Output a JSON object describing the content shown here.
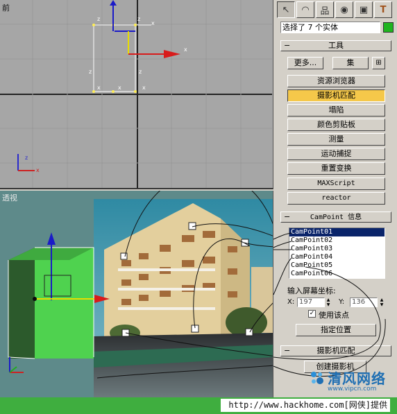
{
  "viewports": {
    "top_label": "前",
    "persp_label": "透视"
  },
  "panel": {
    "tabs": [
      {
        "name": "create-tab-icon",
        "glyph": "↖"
      },
      {
        "name": "modify-tab-icon",
        "glyph": "◠"
      },
      {
        "name": "hierarchy-tab-icon",
        "glyph": "品"
      },
      {
        "name": "motion-tab-icon",
        "glyph": "◉"
      },
      {
        "name": "display-tab-icon",
        "glyph": "▣"
      },
      {
        "name": "utilities-tab-icon",
        "glyph": "T"
      }
    ],
    "selection_text": "选择了 7 个实体",
    "selection_color": "#1fb41f",
    "tools_rollout": "工具",
    "more_button": "更多...",
    "sets_button": "集",
    "buttons": [
      {
        "label": "资源浏览器",
        "highlight": false,
        "mono": false
      },
      {
        "label": "摄影机匹配",
        "highlight": true,
        "mono": false
      },
      {
        "label": "塌陷",
        "highlight": false,
        "mono": false
      },
      {
        "label": "颜色剪贴板",
        "highlight": false,
        "mono": false
      },
      {
        "label": "测量",
        "highlight": false,
        "mono": false
      },
      {
        "label": "运动捕捉",
        "highlight": false,
        "mono": false
      },
      {
        "label": "重置变换",
        "highlight": false,
        "mono": false
      },
      {
        "label": "MAXScript",
        "highlight": false,
        "mono": true
      },
      {
        "label": "reactor",
        "highlight": false,
        "mono": true
      }
    ],
    "campoint_rollout": "CamPoint 信息",
    "campoints": [
      "CamPoint01",
      "CamPoint02",
      "CamPoint03",
      "CamPoint04",
      "CamPoint05",
      "CamPoint06"
    ],
    "screen_coords_label": "输入屏幕坐标:",
    "x_label": "X:",
    "x_value": "197",
    "y_label": "Y:",
    "y_value": "136",
    "use_point_label": "使用该点",
    "assign_position_button": "指定位置",
    "camera_match_rollout": "摄影机匹配",
    "create_camera_button": "创建摄影机"
  },
  "watermark": {
    "title": "清风网络",
    "url": "www.vipcn.com"
  },
  "footer_url": "http://www.hackhome.com[网侠]提供"
}
